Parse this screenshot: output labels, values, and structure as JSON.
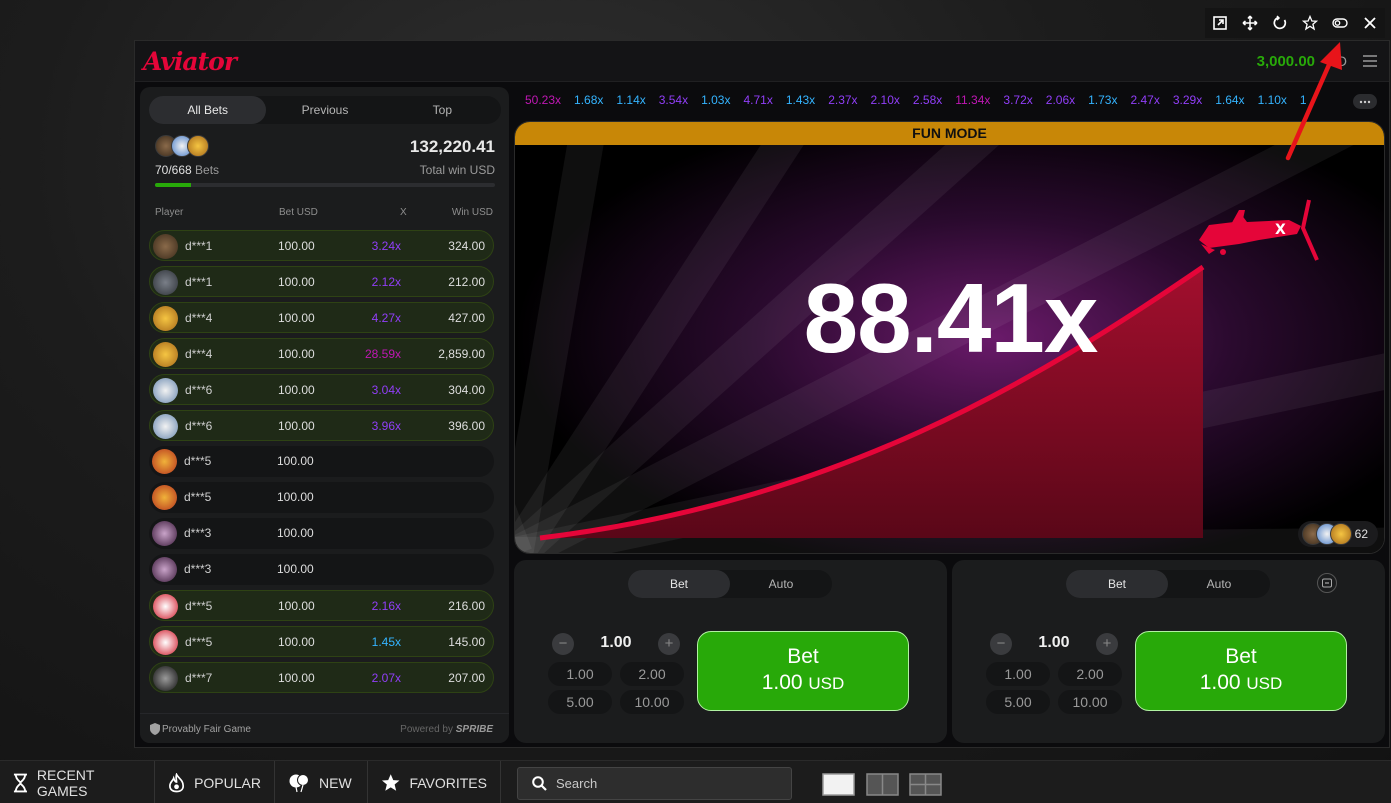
{
  "window_controls": [
    {
      "name": "popout-icon"
    },
    {
      "name": "move-icon"
    },
    {
      "name": "reload-icon"
    },
    {
      "name": "favorite-icon"
    },
    {
      "name": "toggle-icon"
    },
    {
      "name": "close-icon"
    }
  ],
  "header": {
    "logo": "Aviator",
    "balance": "3,000.00",
    "currency_partial": "D"
  },
  "left_panel": {
    "tabs": [
      "All Bets",
      "Previous",
      "Top"
    ],
    "active_tab": "All Bets",
    "bets_count": "70/668",
    "bets_label": "Bets",
    "total_win": "132,220.41",
    "total_win_label": "Total win USD",
    "progress": 0.105,
    "columns": [
      "Player",
      "Bet USD",
      "X",
      "Win USD"
    ],
    "rows": [
      {
        "player": "d***1",
        "bet": "100.00",
        "mult": "3.24x",
        "win": "324.00",
        "mult_color": "#913ef8"
      },
      {
        "player": "d***1",
        "bet": "100.00",
        "mult": "2.12x",
        "win": "212.00",
        "mult_color": "#913ef8"
      },
      {
        "player": "d***4",
        "bet": "100.00",
        "mult": "4.27x",
        "win": "427.00",
        "mult_color": "#913ef8"
      },
      {
        "player": "d***4",
        "bet": "100.00",
        "mult": "28.59x",
        "win": "2,859.00",
        "mult_color": "#c017b4"
      },
      {
        "player": "d***6",
        "bet": "100.00",
        "mult": "3.04x",
        "win": "304.00",
        "mult_color": "#913ef8"
      },
      {
        "player": "d***6",
        "bet": "100.00",
        "mult": "3.96x",
        "win": "396.00",
        "mult_color": "#913ef8"
      },
      {
        "player": "d***5",
        "bet": "100.00",
        "mult": "",
        "win": "",
        "mult_color": ""
      },
      {
        "player": "d***5",
        "bet": "100.00",
        "mult": "",
        "win": "",
        "mult_color": ""
      },
      {
        "player": "d***3",
        "bet": "100.00",
        "mult": "",
        "win": "",
        "mult_color": ""
      },
      {
        "player": "d***3",
        "bet": "100.00",
        "mult": "",
        "win": "",
        "mult_color": ""
      },
      {
        "player": "d***5",
        "bet": "100.00",
        "mult": "2.16x",
        "win": "216.00",
        "mult_color": "#913ef8"
      },
      {
        "player": "d***5",
        "bet": "100.00",
        "mult": "1.45x",
        "win": "145.00",
        "mult_color": "#34b4ff"
      },
      {
        "player": "d***7",
        "bet": "100.00",
        "mult": "2.07x",
        "win": "207.00",
        "mult_color": "#913ef8"
      }
    ],
    "footer_left": "Provably Fair Game",
    "footer_right_prefix": "Powered by",
    "footer_right_brand": "SPRIBE"
  },
  "history": [
    {
      "v": "50.23x",
      "c": "#c017b4"
    },
    {
      "v": "1.68x",
      "c": "#34b4ff"
    },
    {
      "v": "1.14x",
      "c": "#34b4ff"
    },
    {
      "v": "3.54x",
      "c": "#913ef8"
    },
    {
      "v": "1.03x",
      "c": "#34b4ff"
    },
    {
      "v": "4.71x",
      "c": "#913ef8"
    },
    {
      "v": "1.43x",
      "c": "#34b4ff"
    },
    {
      "v": "2.37x",
      "c": "#913ef8"
    },
    {
      "v": "2.10x",
      "c": "#913ef8"
    },
    {
      "v": "2.58x",
      "c": "#913ef8"
    },
    {
      "v": "11.34x",
      "c": "#c017b4"
    },
    {
      "v": "3.72x",
      "c": "#913ef8"
    },
    {
      "v": "2.06x",
      "c": "#913ef8"
    },
    {
      "v": "1.73x",
      "c": "#34b4ff"
    },
    {
      "v": "2.47x",
      "c": "#913ef8"
    },
    {
      "v": "3.29x",
      "c": "#913ef8"
    },
    {
      "v": "1.64x",
      "c": "#34b4ff"
    },
    {
      "v": "1.10x",
      "c": "#34b4ff"
    },
    {
      "v": "1",
      "c": "#34b4ff"
    }
  ],
  "game": {
    "mode_banner": "FUN MODE",
    "multiplier": "88.41x",
    "players_count": "62"
  },
  "bet_panels": [
    {
      "tabs": [
        "Bet",
        "Auto"
      ],
      "amount": "1.00",
      "quick": [
        "1.00",
        "2.00",
        "5.00",
        "10.00"
      ],
      "button_line1": "Bet",
      "button_amount": "1.00",
      "button_currency": "USD"
    },
    {
      "tabs": [
        "Bet",
        "Auto"
      ],
      "amount": "1.00",
      "quick": [
        "1.00",
        "2.00",
        "5.00",
        "10.00"
      ],
      "button_line1": "Bet",
      "button_amount": "1.00",
      "button_currency": "USD"
    }
  ],
  "bottom_bar": {
    "recent": "RECENT GAMES",
    "popular": "POPULAR",
    "new": "NEW",
    "favorites": "FAVORITES",
    "search_placeholder": "Search"
  },
  "colors": {
    "brand_red": "#e50539",
    "balance_green": "#28a909",
    "bet_green": "#28a909",
    "fun_mode": "#c88707"
  }
}
